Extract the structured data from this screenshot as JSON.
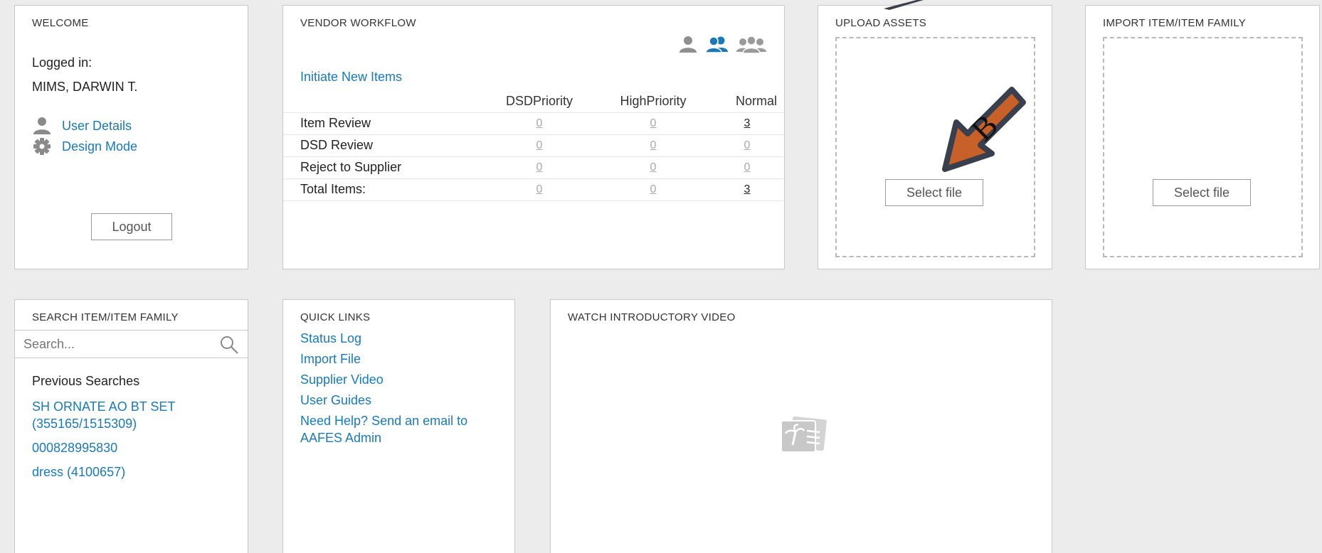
{
  "welcome": {
    "title": "WELCOME",
    "logged_in_label": "Logged in:",
    "user_name": "MIMS, DARWIN T.",
    "user_details_label": "User Details",
    "design_mode_label": "Design Mode",
    "logout_label": "Logout"
  },
  "vendor": {
    "title": "VENDOR WORKFLOW",
    "initiate_label": "Initiate New Items",
    "columns": [
      "DSDPriority",
      "HighPriority",
      "Normal"
    ],
    "rows": [
      {
        "label": "Item Review",
        "values": [
          "0",
          "0",
          "3"
        ]
      },
      {
        "label": "DSD Review",
        "values": [
          "0",
          "0",
          "0"
        ]
      },
      {
        "label": "Reject to Supplier",
        "values": [
          "0",
          "0",
          "0"
        ]
      },
      {
        "label": "Total Items:",
        "values": [
          "0",
          "0",
          "3"
        ]
      }
    ]
  },
  "upload": {
    "title": "UPLOAD ASSETS",
    "button_label": "Select file"
  },
  "import": {
    "title": "IMPORT ITEM/ITEM FAMILY",
    "button_label": "Select file"
  },
  "search": {
    "title": "SEARCH ITEM/ITEM FAMILY",
    "placeholder": "Search...",
    "previous_title": "Previous Searches",
    "previous": [
      "SH ORNATE AO BT SET (355165/1515309)",
      "000828995830",
      "dress (4100657)"
    ]
  },
  "quick": {
    "title": "QUICK LINKS",
    "links": [
      "Status Log",
      "Import File",
      "Supplier Video",
      "User Guides",
      "Need Help? Send an email to AAFES Admin"
    ]
  },
  "video": {
    "title": "WATCH INTRODUCTORY VIDEO"
  },
  "annotation": {
    "letter": "B"
  },
  "colors": {
    "link": "#1a7ab8",
    "arrow_fill": "#c8602a",
    "arrow_stroke": "#3a3f4d"
  }
}
